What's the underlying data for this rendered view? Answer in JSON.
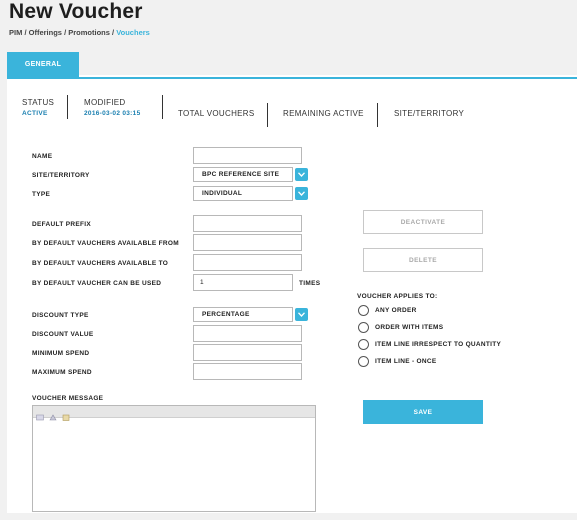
{
  "page": {
    "title": "New Voucher",
    "breadcrumb": {
      "items": [
        "PIM",
        "Offerings",
        "Promotions"
      ],
      "separator": "/",
      "active": "Vouchers"
    }
  },
  "tabs": {
    "general": "GENERAL"
  },
  "info_bar": {
    "status_label": "STATUS",
    "status_value": "ACTIVE",
    "modified_label": "MODIFIED",
    "modified_value": "2016-03-02 03:15",
    "total_vouchers_label": "TOTAL VOUCHERS",
    "remaining_active_label": "REMAINING ACTIVE",
    "site_territory_label": "SITE/TERRITORY"
  },
  "form": {
    "name_label": "NAME",
    "name_value": "",
    "site_territory_label": "SITE/TERRITORY",
    "site_territory_value": "BPC REFERENCE SITE",
    "type_label": "TYPE",
    "type_value": "INDIVIDUAL",
    "default_prefix_label": "DEFAULT PREFIX",
    "available_from_label": "BY DEFAULT VAUCHERS AVAILABLE FROM",
    "available_to_label": "BY DEFAULT VAUCHERS AVAILABLE TO",
    "can_be_used_label": "BY DEFAULT VAUCHER CAN BE USED",
    "can_be_used_value": "1",
    "times_label": "TIMES",
    "discount_type_label": "DISCOUNT TYPE",
    "discount_type_value": "PERCENTAGE",
    "discount_value_label": "DISCOUNT VALUE",
    "minimum_spend_label": "MINIMUM SPEND",
    "maximum_spend_label": "MAXIMUM SPEND",
    "voucher_message_label": "VOUCHER MESSAGE"
  },
  "actions": {
    "deactivate": "DEACTIVATE",
    "delete": "DELETE",
    "save": "SAVE"
  },
  "applies_to": {
    "label": "VOUCHER APPLIES TO:",
    "options": [
      "ANY ORDER",
      "ORDER WITH ITEMS",
      "ITEM LINE IRRESPECT TO QUANTITY",
      "ITEM LINE - ONCE"
    ]
  },
  "colors": {
    "accent": "#3ab4db",
    "status_value": "#1a7fb0",
    "disabled_text": "#a9a9a9"
  }
}
